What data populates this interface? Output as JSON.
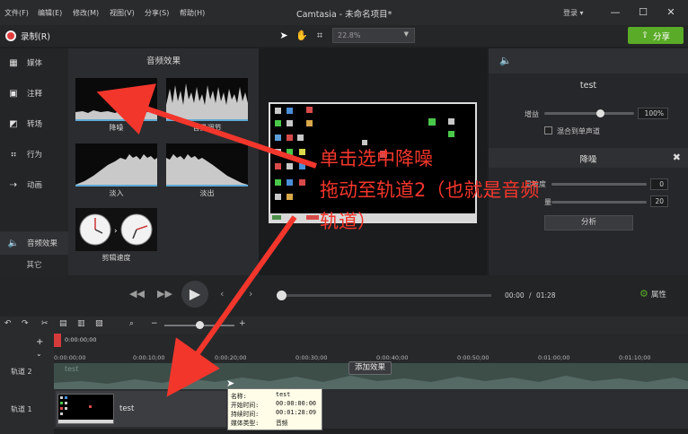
{
  "menubar": {
    "items": [
      "文件(F)",
      "编辑(E)",
      "修改(M)",
      "视图(V)",
      "分享(S)",
      "帮助(H)"
    ],
    "title": "Camtasia - 未命名项目*",
    "login": "登录 ▾",
    "minimize": "—",
    "maximize": "☐",
    "close": "✕"
  },
  "toolbar": {
    "record_label": "录制(R)",
    "zoom_value": "22.8%",
    "share_label": "分享"
  },
  "sidebar": {
    "items": [
      {
        "label": "媒体",
        "icon": "film-icon"
      },
      {
        "label": "注释",
        "icon": "annotation-icon"
      },
      {
        "label": "转场",
        "icon": "transition-icon"
      },
      {
        "label": "行为",
        "icon": "behavior-icon"
      },
      {
        "label": "动画",
        "icon": "animation-icon"
      },
      {
        "label": "音频效果",
        "icon": "speaker-icon"
      }
    ],
    "more": "其它"
  },
  "effects": {
    "title": "音频效果",
    "items": [
      {
        "label": "降噪"
      },
      {
        "label": "音量调节"
      },
      {
        "label": "淡入"
      },
      {
        "label": "淡出"
      },
      {
        "label": "剪辑速度"
      }
    ]
  },
  "properties": {
    "title": "test",
    "gain_label": "增益",
    "gain_value": "100%",
    "gain_level": 0.62,
    "mono_label": "混合到单声道",
    "noise_title": "降噪",
    "sensitivity_label": "灵敏度",
    "sensitivity_value": "0",
    "amount_label": "量",
    "amount_value": "20",
    "analyze_label": "分析"
  },
  "playback": {
    "current": "00:00",
    "separator": "/",
    "total": "01:28",
    "properties_label": "属性"
  },
  "timeline": {
    "playhead": "0:00:00;00",
    "ruler": [
      "0:00:00;00",
      "0:00:10;00",
      "0:00:20;00",
      "0:00:30;00",
      "0:00:40;00",
      "0:00:50;00",
      "0:01:00;00",
      "0:01:10;00"
    ],
    "track2": "轨道 2",
    "track1": "轨道 1",
    "track2_ghost": "test",
    "clip1_name": "test",
    "drop_label": "添加效果"
  },
  "tooltip": {
    "rows": [
      {
        "k": "名称:",
        "v": "test"
      },
      {
        "k": "开始时间:",
        "v": "00:00:00:00"
      },
      {
        "k": "持续时间:",
        "v": "00:01:28:09"
      },
      {
        "k": "媒体类型:",
        "v": "音频"
      }
    ]
  },
  "annotation": {
    "lines": [
      "单击选中降噪",
      "拖动至轨道2（也就是音频",
      "轨道）"
    ]
  },
  "colors": {
    "accent_green": "#5aab27",
    "annotation_red": "#f2362c",
    "record_red": "#e23b3b"
  }
}
